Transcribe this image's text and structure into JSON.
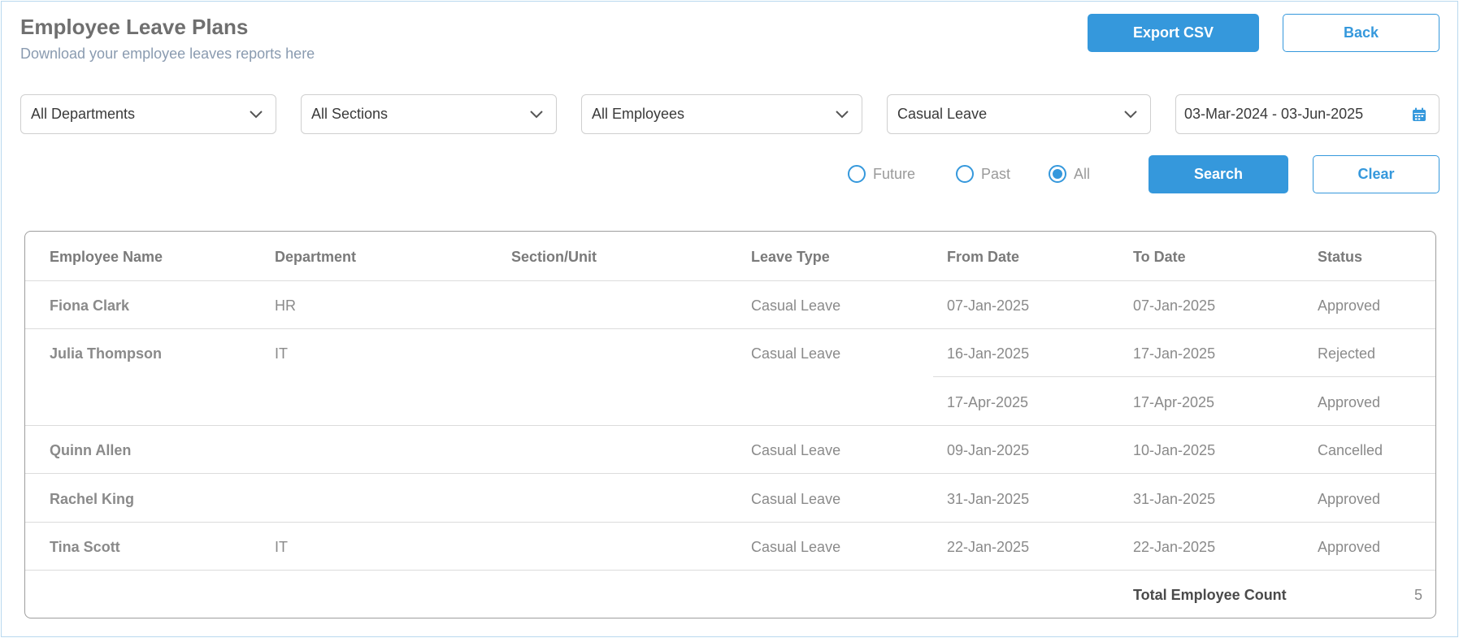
{
  "header": {
    "title": "Employee Leave Plans",
    "subtitle": "Download your employee leaves reports here",
    "export_label": "Export CSV",
    "back_label": "Back"
  },
  "filters": {
    "department": "All Departments",
    "section": "All Sections",
    "employee": "All Employees",
    "leave_type": "Casual Leave",
    "date_range": "03-Mar-2024 - 03-Jun-2025",
    "radios": [
      {
        "label": "Future",
        "selected": false
      },
      {
        "label": "Past",
        "selected": false
      },
      {
        "label": "All",
        "selected": true
      }
    ],
    "search_label": "Search",
    "clear_label": "Clear"
  },
  "table": {
    "columns": [
      "Employee Name",
      "Department",
      "Section/Unit",
      "Leave Type",
      "From Date",
      "To Date",
      "Status"
    ],
    "rows": [
      {
        "name": "Fiona Clark",
        "department": "HR",
        "section": "",
        "leave_type": "Casual Leave",
        "leaves": [
          {
            "from": "07-Jan-2025",
            "to": "07-Jan-2025",
            "status": "Approved"
          }
        ]
      },
      {
        "name": "Julia Thompson",
        "department": "IT",
        "section": "",
        "leave_type": "Casual Leave",
        "leaves": [
          {
            "from": "16-Jan-2025",
            "to": "17-Jan-2025",
            "status": "Rejected"
          },
          {
            "from": "17-Apr-2025",
            "to": "17-Apr-2025",
            "status": "Approved"
          }
        ]
      },
      {
        "name": "Quinn Allen",
        "department": "",
        "section": "",
        "leave_type": "Casual Leave",
        "leaves": [
          {
            "from": "09-Jan-2025",
            "to": "10-Jan-2025",
            "status": "Cancelled"
          }
        ]
      },
      {
        "name": "Rachel King",
        "department": "",
        "section": "",
        "leave_type": "Casual Leave",
        "leaves": [
          {
            "from": "31-Jan-2025",
            "to": "31-Jan-2025",
            "status": "Approved"
          }
        ]
      },
      {
        "name": "Tina Scott",
        "department": "IT",
        "section": "",
        "leave_type": "Casual Leave",
        "leaves": [
          {
            "from": "22-Jan-2025",
            "to": "22-Jan-2025",
            "status": "Approved"
          }
        ]
      }
    ],
    "total_label": "Total Employee Count",
    "total_value": "5"
  },
  "icons": {
    "dropdown": "chevron-down-icon",
    "date": "calendar-icon"
  },
  "colors": {
    "accent": "#3598dc",
    "frame_border": "#b9d9ef",
    "table_border": "#9e9e9e"
  }
}
